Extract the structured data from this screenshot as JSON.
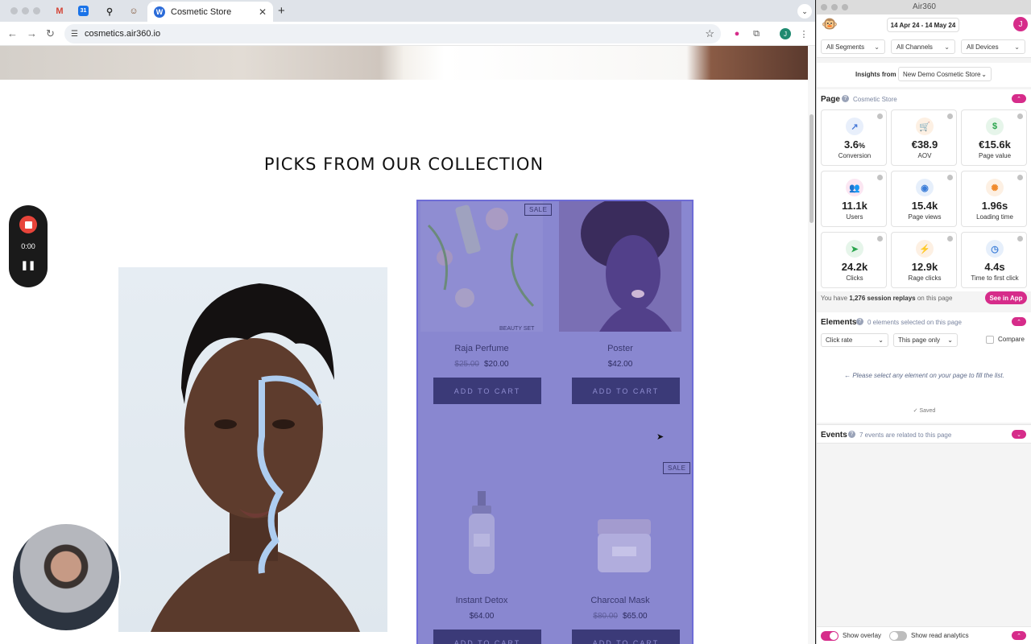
{
  "browser": {
    "active_tab_title": "Cosmetic Store",
    "url": "cosmetics.air360.io",
    "favicons": [
      "M",
      "31",
      "⚲",
      "☺"
    ]
  },
  "page": {
    "heading": "PICKS FROM OUR COLLECTION",
    "products": [
      {
        "name": "Raja Perfume",
        "old_price": "$25.00",
        "price": "$20.00",
        "sale": "SALE",
        "tag": "BEAUTY SET",
        "button": "ADD TO CART"
      },
      {
        "name": "Poster",
        "old_price": "",
        "price": "$42.00",
        "sale": "",
        "tag": "",
        "button": "ADD TO CART"
      },
      {
        "name": "Instant Detox",
        "old_price": "",
        "price": "$64.00",
        "sale": "",
        "tag": "",
        "button": "ADD TO CART"
      },
      {
        "name": "Charcoal Mask",
        "old_price": "$80.00",
        "price": "$65.00",
        "sale": "SALE",
        "tag": "",
        "button": "ADD TO CART"
      }
    ]
  },
  "recorder": {
    "time": "0:00"
  },
  "panel": {
    "title": "Air360",
    "date_range": "14 Apr 24 - 14 May 24",
    "avatar": "J",
    "filters": [
      "All Segments",
      "All Channels",
      "All Devices"
    ],
    "insights_label": "Insights from",
    "insights_source": "New Demo Cosmetic Store",
    "page_section": {
      "title": "Page",
      "subtitle": "Cosmetic Store"
    },
    "metrics": [
      {
        "value": "3.6",
        "unit": "%",
        "label": "Conversion",
        "icon": "trend-up-icon",
        "glyph": "↗",
        "color": "#4a7bd8",
        "bg": "#e8effb"
      },
      {
        "value": "€38.9",
        "unit": "",
        "label": "AOV",
        "icon": "cart-icon",
        "glyph": "🛒",
        "color": "#f08a2c",
        "bg": "#fdf0e3"
      },
      {
        "value": "€15.6k",
        "unit": "",
        "label": "Page value",
        "icon": "dollar-icon",
        "glyph": "$",
        "color": "#2aa54d",
        "bg": "#e6f5ea"
      },
      {
        "value": "11.1k",
        "unit": "",
        "label": "Users",
        "icon": "users-icon",
        "glyph": "👥",
        "color": "#d62c8a",
        "bg": "#fbe6f2"
      },
      {
        "value": "15.4k",
        "unit": "",
        "label": "Page views",
        "icon": "eye-icon",
        "glyph": "◉",
        "color": "#3b7dd8",
        "bg": "#e6effb"
      },
      {
        "value": "1.96s",
        "unit": "",
        "label": "Loading time",
        "icon": "spinner-icon",
        "glyph": "✺",
        "color": "#f08a2c",
        "bg": "#fdf0e3"
      },
      {
        "value": "24.2k",
        "unit": "",
        "label": "Clicks",
        "icon": "pointer-icon",
        "glyph": "➤",
        "color": "#2aa54d",
        "bg": "#e6f5ea"
      },
      {
        "value": "12.9k",
        "unit": "",
        "label": "Rage clicks",
        "icon": "bolt-icon",
        "glyph": "⚡",
        "color": "#f08a2c",
        "bg": "#fdf0e3"
      },
      {
        "value": "4.4s",
        "unit": "",
        "label": "Time to first click",
        "icon": "clock-icon",
        "glyph": "◷",
        "color": "#3b7dd8",
        "bg": "#e6effb"
      }
    ],
    "replays_prefix": "You have",
    "replays_count": "1,276 session replays",
    "replays_suffix": "on this page",
    "see_in_app": "See in App",
    "elements_section": {
      "title": "Elements",
      "subtitle": "0 elements selected on this page"
    },
    "elements_metric": "Click rate",
    "elements_scope": "This page only",
    "compare_label": "Compare",
    "elements_hint": "Please select any element on your page to fill the list.",
    "saved_label": "✓ Saved",
    "events_section": {
      "title": "Events",
      "subtitle": "7 events are related to this page"
    },
    "show_overlay": "Show overlay",
    "show_read_analytics": "Show read analytics"
  }
}
